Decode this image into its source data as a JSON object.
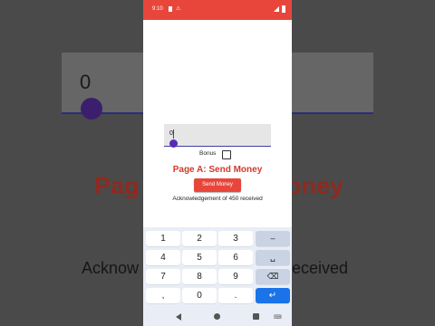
{
  "status_bar": {
    "time": "9:10",
    "icon2": "⚠"
  },
  "amount_input": {
    "value": "0"
  },
  "bonus": {
    "label": "Bonus",
    "checked": false
  },
  "page": {
    "title": "Page A: Send Money",
    "send_button": "Send Money",
    "acknowledgement": "Acknowledgement of 450 received"
  },
  "background_blur": {
    "input_value": "0",
    "title_left": "Pag",
    "title_right": "oney",
    "ack_left": "Acknow",
    "ack_right": "eceived"
  },
  "keyboard": {
    "row1": [
      "1",
      "2",
      "3",
      "–"
    ],
    "row2": [
      "4",
      "5",
      "6",
      "␣"
    ],
    "row3": [
      "7",
      "8",
      "9",
      "⌫"
    ],
    "row4": [
      ",",
      "0",
      ".",
      "↵"
    ]
  },
  "colors": {
    "accent": "#e8463b",
    "title": "#d23a2b",
    "field_underline": "#3d3fa8",
    "handle": "#5a2ab5",
    "enter": "#1a73e8"
  }
}
